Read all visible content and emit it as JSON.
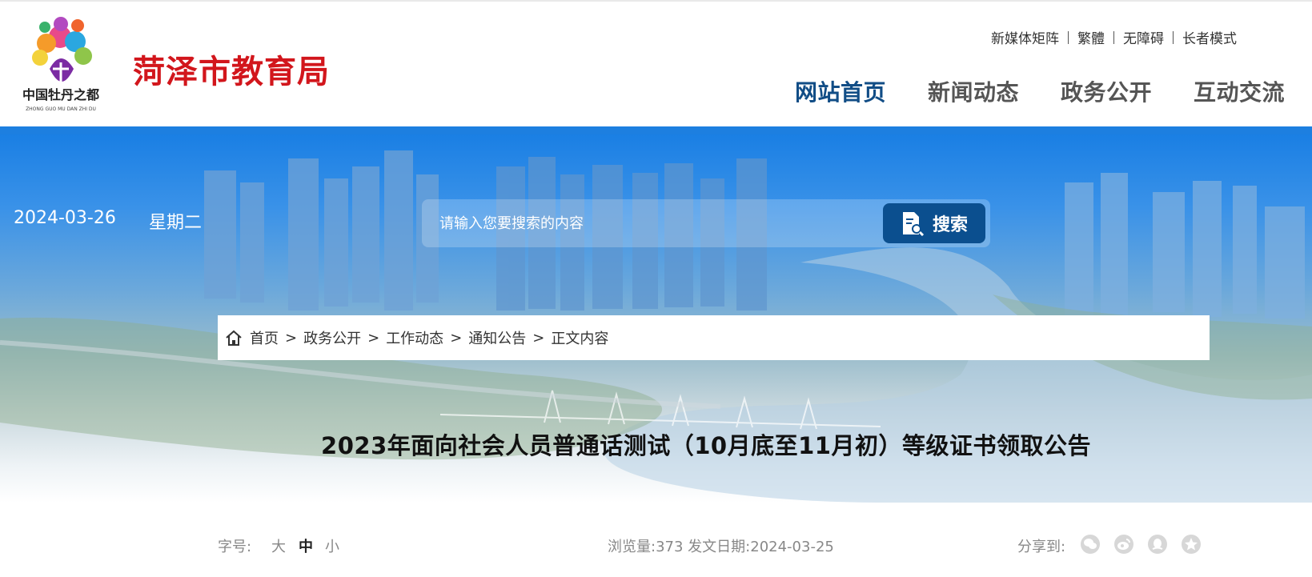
{
  "header": {
    "logo_alt": "中国牡丹之都",
    "logo_caption": "ZHONG GUO MU DAN ZHI DU",
    "site_name": "菏泽市教育局",
    "top_links": [
      "新媒体矩阵",
      "繁體",
      "无障碍",
      "长者模式"
    ],
    "nav": [
      {
        "label": "网站首页",
        "active": true
      },
      {
        "label": "新闻动态",
        "active": false
      },
      {
        "label": "政务公开",
        "active": false
      },
      {
        "label": "互动交流",
        "active": false
      }
    ]
  },
  "banner": {
    "date": "2024-03-26",
    "weekday": "星期二",
    "search_placeholder": "请输入您要搜索的内容",
    "search_button": "搜索"
  },
  "breadcrumb": {
    "items": [
      "首页",
      "政务公开",
      "工作动态",
      "通知公告",
      "正文内容"
    ],
    "separator": ">"
  },
  "article": {
    "title": "2023年面向社会人员普通话测试（10月底至11月初）等级证书领取公告",
    "font_size_label": "字号:",
    "font_sizes": [
      "大",
      "中",
      "小"
    ],
    "views_label": "浏览量:",
    "views": "373",
    "date_label": "发文日期:",
    "date": "2024-03-25",
    "share_label": "分享到:"
  },
  "share_icons": [
    "wechat-icon",
    "weibo-icon",
    "qq-icon",
    "qzone-icon"
  ],
  "colors": {
    "brand_red": "#d2161c",
    "nav_active": "#114d86",
    "blue_bar": "#1d7fe0",
    "search_button": "#0b4f8f"
  }
}
